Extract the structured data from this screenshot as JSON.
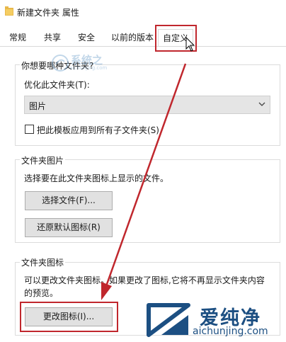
{
  "window": {
    "title": "新建文件夹 属性",
    "icon": "folder-icon"
  },
  "tabs": [
    {
      "label": "常规",
      "active": false
    },
    {
      "label": "共享",
      "active": false
    },
    {
      "label": "安全",
      "active": false
    },
    {
      "label": "以前的版本",
      "active": false
    },
    {
      "label": "自定义",
      "active": true
    }
  ],
  "optimize_group": {
    "legend": "你想要哪种文件夹?",
    "optimize_label": "优化此文件夹(T):",
    "select_value": "图片",
    "checkbox_label": "把此模板应用到所有子文件夹(S)",
    "checkbox_checked": false
  },
  "folder_picture_group": {
    "legend": "文件夹图片",
    "description": "选择要在此文件夹图标上显示的文件。",
    "choose_file_button": "选择文件(F)...",
    "restore_default_button": "还原默认图标(R)"
  },
  "folder_icon_group": {
    "legend": "文件夹图标",
    "description_line1": "可以更改文件夹图标。如果更改了图标,它将不再显示文件夹内容",
    "description_line2": "的预览。",
    "change_icon_button": "更改图标(I)..."
  },
  "watermarks": {
    "top_text": "系统之",
    "top_subtext": "aichunjing.com",
    "bottom_logo_text": "爱纯净",
    "bottom_logo_url": "aichunjing.com"
  },
  "colors": {
    "highlight_red": "#c0272d",
    "logo_blue": "#1c4f82",
    "button_face": "#e1e1e1"
  }
}
